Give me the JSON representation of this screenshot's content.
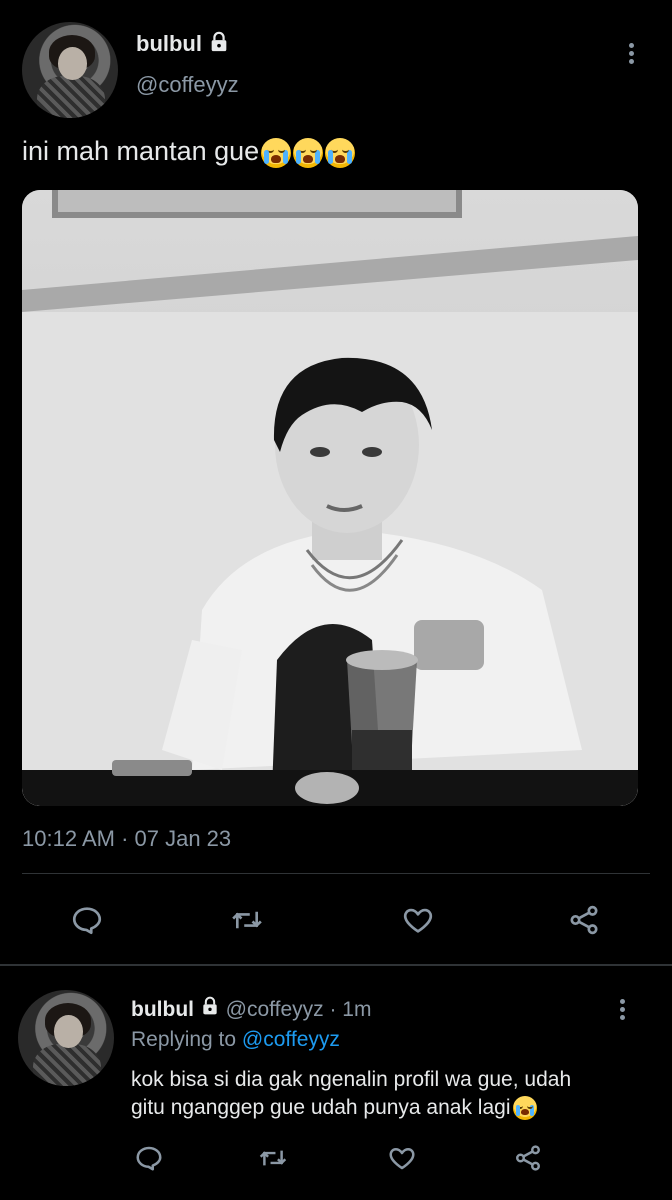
{
  "tweet": {
    "author_name": "bulbul",
    "author_handle": "@coffeyyz",
    "text": "ini mah mantan gue",
    "emoji": "loudly-crying-face",
    "emoji_count": 3,
    "timestamp": "10:12 AM · 07 Jan 23",
    "image_alt_icon": "photo"
  },
  "actions": {
    "reply_icon": "reply-icon",
    "retweet_icon": "retweet-icon",
    "like_icon": "heart-icon",
    "share_icon": "share-icon"
  },
  "reply": {
    "author_name": "bulbul",
    "author_handle": "@coffeyyz",
    "time": "· 1m",
    "replying_label": "Replying to",
    "replying_to": "@coffeyyz",
    "text_line1": "kok bisa si dia gak ngenalin profil wa gue, udah",
    "text_line2": "gitu nganggep gue udah punya anak lagi"
  },
  "colors": {
    "background": "#000000",
    "text": "#e7e9ea",
    "muted": "#8b98a5",
    "link": "#1d9bf0",
    "divider": "#2f3336"
  }
}
